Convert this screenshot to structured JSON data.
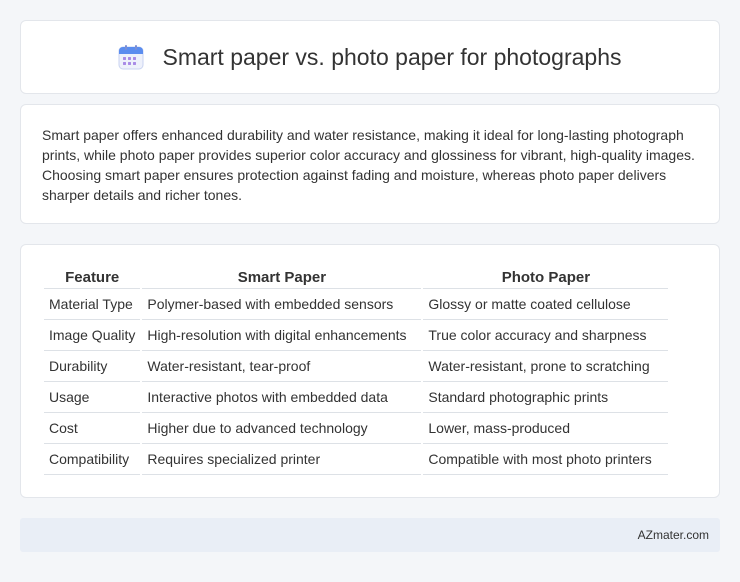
{
  "header": {
    "icon": "calendar-icon",
    "title": "Smart paper vs. photo paper for photographs"
  },
  "summary": {
    "text": "Smart paper offers enhanced durability and water resistance, making it ideal for long-lasting photograph prints, while photo paper provides superior color accuracy and glossiness for vibrant, high-quality images. Choosing smart paper ensures protection against fading and moisture, whereas photo paper delivers sharper details and richer tones."
  },
  "table": {
    "headers": [
      "Feature",
      "Smart Paper",
      "Photo Paper"
    ],
    "rows": [
      [
        "Material Type",
        "Polymer-based with embedded sensors",
        "Glossy or matte coated cellulose"
      ],
      [
        "Image Quality",
        "High-resolution with digital enhancements",
        "True color accuracy and sharpness"
      ],
      [
        "Durability",
        "Water-resistant, tear-proof",
        "Water-resistant, prone to scratching"
      ],
      [
        "Usage",
        "Interactive photos with embedded data",
        "Standard photographic prints"
      ],
      [
        "Cost",
        "Higher due to advanced technology",
        "Lower, mass-produced"
      ],
      [
        "Compatibility",
        "Requires specialized printer",
        "Compatible with most photo printers"
      ]
    ]
  },
  "footer": {
    "brand": "AZmater.com"
  },
  "colors": {
    "background": "#f4f6f9",
    "card": "#ffffff",
    "footer": "#e9eef6",
    "icon_blue": "#5b8def",
    "icon_purple": "#a98be6"
  }
}
